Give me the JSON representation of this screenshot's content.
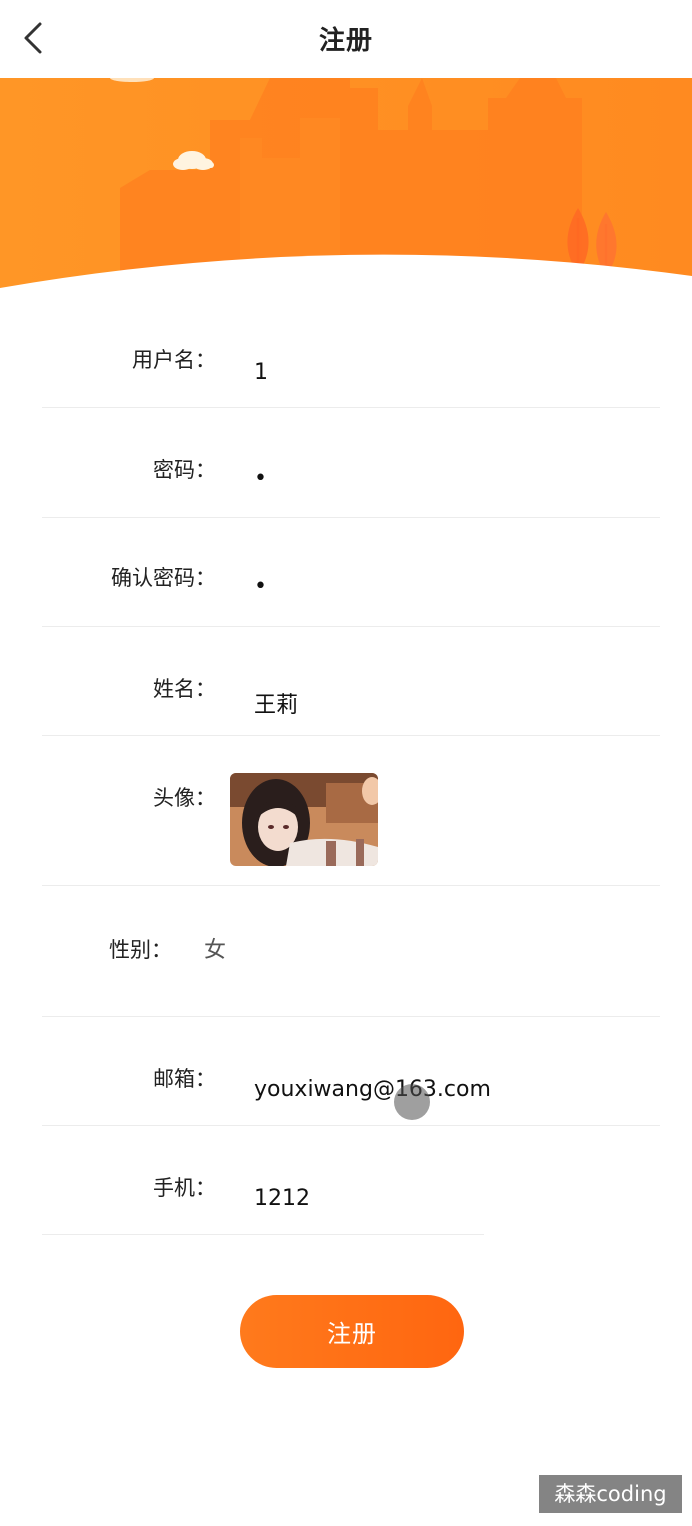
{
  "header": {
    "title": "注册",
    "back_icon": "chevron-left-icon"
  },
  "colors": {
    "accent": "#ff6a13",
    "banner_light": "#ff9a2e",
    "banner_dark": "#ff7a1e"
  },
  "form": {
    "username": {
      "label": "用户名：",
      "value": "1"
    },
    "password": {
      "label": "密码：",
      "value": "•"
    },
    "confirm_password": {
      "label": "确认密码：",
      "value": "•"
    },
    "name": {
      "label": "姓名：",
      "value": "王莉"
    },
    "avatar": {
      "label": "头像："
    },
    "gender": {
      "label": "性别：",
      "value": "女"
    },
    "email": {
      "label": "邮箱：",
      "value": "youxiwang@163.com"
    },
    "phone": {
      "label": "手机：",
      "value": "1212"
    }
  },
  "submit": {
    "label": "注册"
  },
  "watermark": "森森coding"
}
